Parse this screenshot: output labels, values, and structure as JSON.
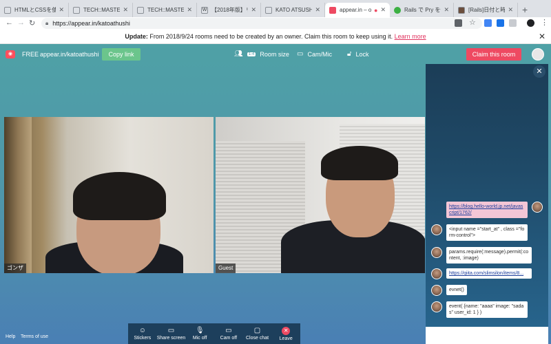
{
  "browser": {
    "tabs": [
      {
        "title": "HTMLとCSSを使っ",
        "fav": ""
      },
      {
        "title": "TECH::MASTER",
        "fav": ""
      },
      {
        "title": "TECH::MASTER",
        "fav": ""
      },
      {
        "title": "【2018年版】リセッ",
        "fav": "W"
      },
      {
        "title": "KATO ATSUSHI",
        "fav": ""
      },
      {
        "title": "appear.in – on",
        "fav": ""
      },
      {
        "title": "Rails で Pry を使う",
        "fav": ""
      },
      {
        "title": "[Rails]日付と時間の",
        "fav": ""
      }
    ],
    "new_tab": "+",
    "url": "https://appear.in/katoathushi",
    "nav": {
      "back": "←",
      "forward": "→",
      "reload": "↻"
    }
  },
  "banner": {
    "prefix": "Update:",
    "text": "From 2018/9/24 rooms need to be created by an owner. Claim this room to keep using it.",
    "link": "Learn more",
    "close": "✕"
  },
  "topbar": {
    "plan": "FREE",
    "room_url": "appear.in/katoathushi",
    "copy_link": "Copy link",
    "room_size": "Room size",
    "room_size_badge": "1-4",
    "cam_mic": "Cam/Mic",
    "lock": "Lock",
    "claim": "Claim this room"
  },
  "videos": {
    "left_label": "ゴンザ",
    "right_label": "Guest"
  },
  "chat": {
    "close": "✕",
    "messages": [
      {
        "text": "https://blog.hello-world.jp.net/javascript/1762/",
        "mine": true,
        "link": true
      },
      {
        "text": "<input name =\"start_at\" , class =\"form-control\">",
        "mine": false,
        "link": false
      },
      {
        "text": "params.require(:message).permit(:content, :image)",
        "mine": false,
        "link": false
      },
      {
        "text": "https://qiita.com/slimsilon/items/8...",
        "mine": false,
        "link": true
      },
      {
        "text": "evnet()",
        "mine": false,
        "link": false
      },
      {
        "text": "event( {name: \"aaaa\" image: \"sadas\" user_id: 1 } )",
        "mine": false,
        "link": false
      }
    ]
  },
  "bottombar": {
    "stickers": "Stickers",
    "share_screen": "Share screen",
    "mic_off": "Mic off",
    "cam_off": "Cam off",
    "close_chat": "Close chat",
    "leave": "Leave"
  },
  "footer": {
    "help": "Help",
    "terms": "Terms of use"
  },
  "colors": {
    "copy_link": "#6bc58c",
    "claim": "#ee4a62",
    "banner_link": "#e0325e",
    "toolbar": "#1d3f5c"
  }
}
